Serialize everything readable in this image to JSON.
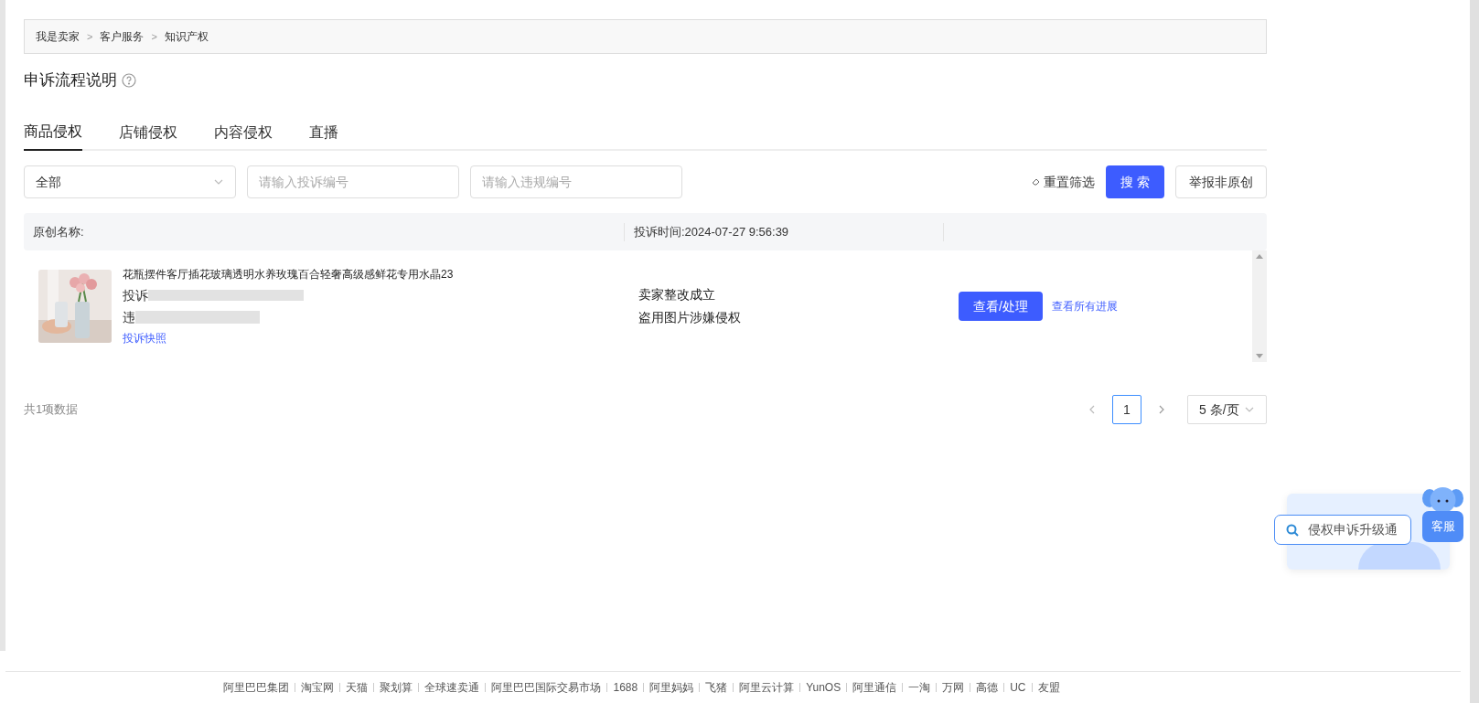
{
  "breadcrumb": [
    "我是卖家",
    "客户服务",
    "知识产权"
  ],
  "breadcrumb_separator": ">",
  "title": "申诉流程说明",
  "tabs": [
    {
      "label": "商品侵权",
      "selected": true
    },
    {
      "label": "店铺侵权",
      "selected": false
    },
    {
      "label": "内容侵权",
      "selected": false
    },
    {
      "label": "直播",
      "selected": false
    }
  ],
  "filters": {
    "type_select": "全部",
    "complaint_no": {
      "placeholder": "请输入投诉编号"
    },
    "violation_no": {
      "placeholder": "请输入违规编号"
    },
    "reset": "重置筛选",
    "search": "搜 索",
    "report": "举报非原创"
  },
  "table": {
    "columns": [
      "原创名称:",
      "投诉时间:2024-07-27 9:56:39"
    ],
    "rows": [
      {
        "product": "花瓶摆件客厅插花玻璃透明水养玫瑰百合轻奢高级感鲜花专用水晶23",
        "complaint_prefix": "投诉",
        "violation_prefix": "违",
        "snapshot_link": "投诉快照",
        "status": "卖家整改成立",
        "reason": "盗用图片涉嫌侵权",
        "action": "查看/处理",
        "progress_link": "查看所有进展"
      }
    ]
  },
  "pagination": {
    "total": "共1项数据",
    "pages": [
      {
        "label": "1",
        "selected": true
      }
    ],
    "page_size": "5 条/页"
  },
  "widget": {
    "search": "侵权申诉升级通",
    "service": "客服"
  },
  "footer": [
    "阿里巴巴集团",
    "淘宝网",
    "天猫",
    "聚划算",
    "全球速卖通",
    "阿里巴巴国际交易市场",
    "1688",
    "阿里妈妈",
    "飞猪",
    "阿里云计算",
    "YunOS",
    "阿里通信",
    "一淘",
    "万网",
    "高德",
    "UC",
    "友盟"
  ]
}
